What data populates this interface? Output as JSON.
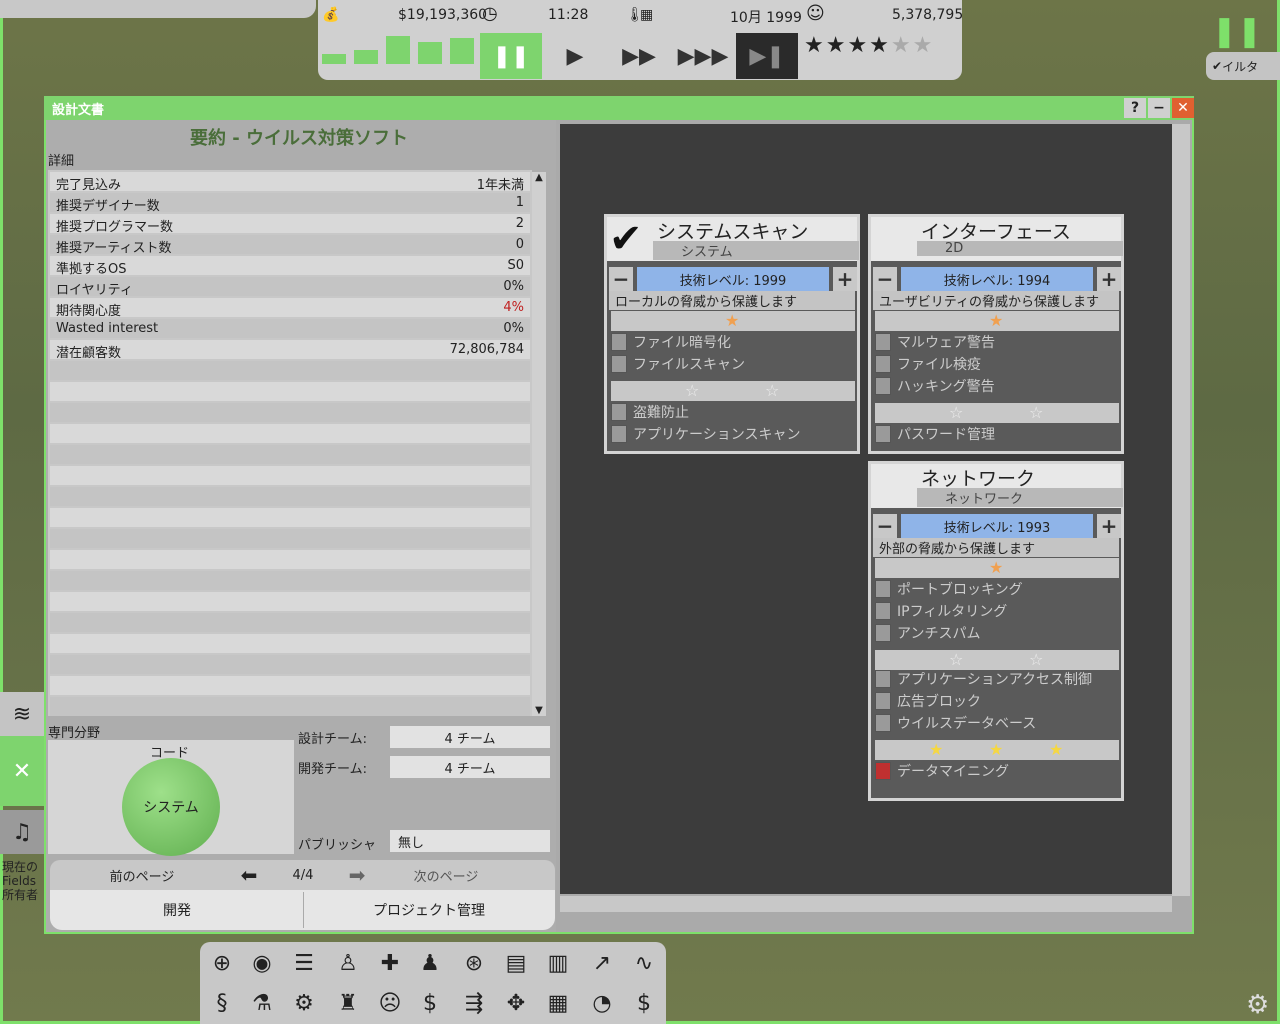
{
  "hud": {
    "money": "$19,193,360",
    "time": "11:28",
    "date": "10月 1999",
    "fans": "5,378,795",
    "stars_filled": 4,
    "stars_total": 6
  },
  "filter_label": "イルタ",
  "side": {
    "text_line1": "現在の",
    "text_line2": "Fields",
    "text_line3": "所有者"
  },
  "window": {
    "title": "設計文書",
    "help": "?",
    "minimize": "−",
    "close": "✕",
    "summary_title": "要約 - ウイルス対策ソフト",
    "detail_label": "詳細",
    "details": [
      {
        "label": "完了見込み",
        "value": "1年未満"
      },
      {
        "label": "推奨デザイナー数",
        "value": "1"
      },
      {
        "label": "推奨プログラマー数",
        "value": "2"
      },
      {
        "label": "推奨アーティスト数",
        "value": "0"
      },
      {
        "label": "準拠するOS",
        "value": "S0"
      },
      {
        "label": "ロイヤリティ",
        "value": "0%"
      },
      {
        "label": "期待関心度",
        "value": "4%"
      },
      {
        "label": "Wasted interest",
        "value": "0%"
      },
      {
        "label": "潜在顧客数",
        "value": "72,806,784"
      }
    ],
    "specialty_label": "専門分野",
    "specialty_category": "コード",
    "specialty_name": "システム",
    "design_team_label": "設計チーム:",
    "design_team_value": "4 チーム",
    "dev_team_label": "開発チーム:",
    "dev_team_value": "4 チーム",
    "publisher_label": "パブリッシャ",
    "publisher_value": "無し",
    "prev_page": "前のページ",
    "page": "4/4",
    "next_page": "次のページ",
    "develop": "開発",
    "project_mgmt": "プロジェクト管理"
  },
  "cards": [
    {
      "title": "システムスキャン",
      "sub": "システム",
      "tech": "技術レベル: 1999",
      "desc": "ローカルの脅威から保護します",
      "groups": [
        {
          "stars": 1,
          "features": [
            "ファイル暗号化",
            "ファイルスキャン"
          ]
        },
        {
          "stars": 2,
          "features": [
            "盗難防止",
            "アプリケーションスキャン"
          ]
        }
      ]
    },
    {
      "title": "インターフェース",
      "sub": "2D",
      "tech": "技術レベル: 1994",
      "desc": "ユーザビリティの脅威から保護します",
      "groups": [
        {
          "stars": 1,
          "features": [
            "マルウェア警告",
            "ファイル検疫",
            "ハッキング警告"
          ]
        },
        {
          "stars": 2,
          "features": [
            "パスワード管理"
          ]
        }
      ]
    },
    {
      "title": "ネットワーク",
      "sub": "ネットワーク",
      "tech": "技術レベル: 1993",
      "desc": "外部の脅威から保護します",
      "groups": [
        {
          "stars": 1,
          "features": [
            "ポートブロッキング",
            "IPフィルタリング",
            "アンチスパム"
          ]
        },
        {
          "stars": 2,
          "features": [
            "アプリケーションアクセス制御",
            "広告ブロック",
            "ウイルスデータベース"
          ]
        },
        {
          "stars": 3,
          "features": [
            "データマイニング"
          ]
        }
      ]
    }
  ],
  "colors": {
    "accent": "#7ed46e",
    "tech": "#8fb4e8",
    "star_orange": "#f0a050",
    "star_gold": "#f5d742"
  }
}
